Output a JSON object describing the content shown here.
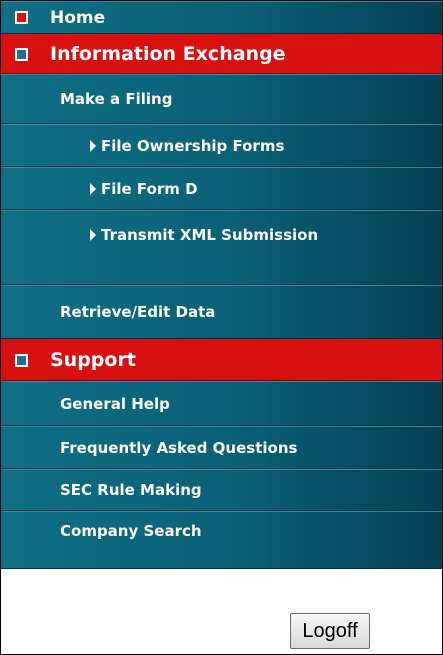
{
  "menu": {
    "home": "Home",
    "information_exchange": "Information Exchange",
    "make_a_filing": "Make a Filing",
    "filing_items": [
      "File Ownership Forms",
      "File Form D",
      "Transmit XML Submission"
    ],
    "retrieve_edit": "Retrieve/Edit Data",
    "support": "Support",
    "support_items": [
      "General Help",
      "Frequently Asked Questions",
      "SEC Rule Making",
      "Company Search"
    ]
  },
  "logoff_label": "Logoff",
  "colors": {
    "header_red": "#d81010",
    "teal": "#0a5f74"
  }
}
